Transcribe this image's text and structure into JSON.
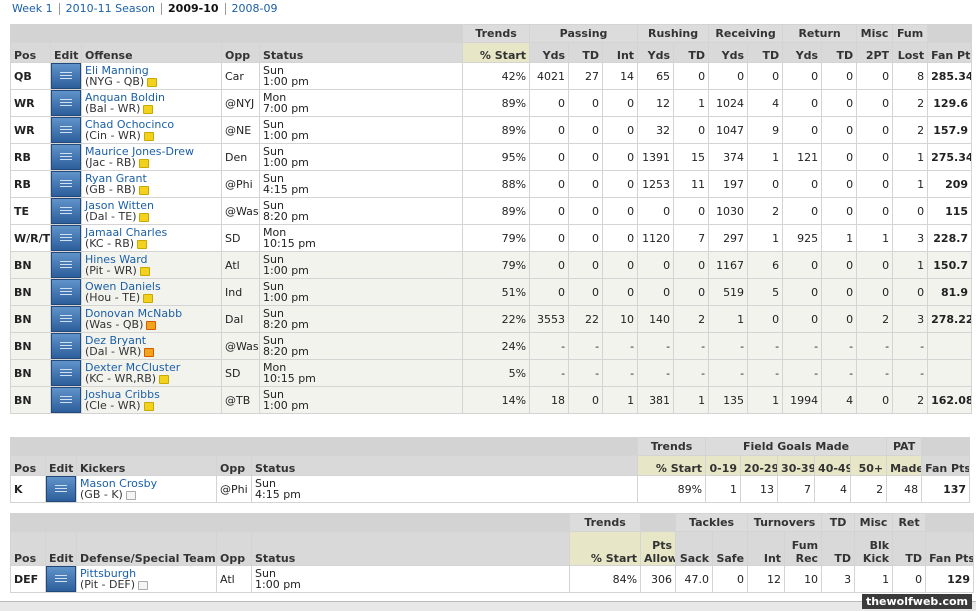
{
  "nav": {
    "items": [
      {
        "label": "Week 1",
        "current": false
      },
      {
        "label": "2010-11 Season",
        "current": false
      },
      {
        "label": "2009-10",
        "current": true
      },
      {
        "label": "2008-09",
        "current": false
      }
    ]
  },
  "offense": {
    "groups": [
      "Trends",
      "Passing",
      "Rushing",
      "Receiving",
      "Return",
      "Misc",
      "Fum"
    ],
    "headers": {
      "pos": "Pos",
      "edit": "Edit",
      "name": "Offense",
      "opp": "Opp",
      "status": "Status",
      "cols": [
        "% Start",
        "Yds",
        "TD",
        "Int",
        "Yds",
        "TD",
        "Yds",
        "TD",
        "Yds",
        "TD",
        "2PT",
        "Lost",
        "Fan Pts"
      ]
    },
    "rows": [
      {
        "pos": "QB",
        "name": "Eli Manning",
        "team": "(NYG - QB)",
        "note": "yellow",
        "opp": "Car",
        "s1": "Sun",
        "s2": "1:00 pm",
        "v": [
          "42%",
          "4021",
          "27",
          "14",
          "65",
          "0",
          "0",
          "0",
          "0",
          "0",
          "0",
          "8",
          "285.34"
        ]
      },
      {
        "pos": "WR",
        "name": "Anquan Boldin",
        "team": "(Bal - WR)",
        "note": "yellow",
        "opp": "@NYJ",
        "s1": "Mon",
        "s2": "7:00 pm",
        "v": [
          "89%",
          "0",
          "0",
          "0",
          "12",
          "1",
          "1024",
          "4",
          "0",
          "0",
          "0",
          "2",
          "129.6"
        ]
      },
      {
        "pos": "WR",
        "name": "Chad Ochocinco",
        "team": "(Cin - WR)",
        "note": "yellow",
        "opp": "@NE",
        "s1": "Sun",
        "s2": "1:00 pm",
        "v": [
          "89%",
          "0",
          "0",
          "0",
          "32",
          "0",
          "1047",
          "9",
          "0",
          "0",
          "0",
          "2",
          "157.9"
        ]
      },
      {
        "pos": "RB",
        "name": "Maurice Jones-Drew",
        "team": "(Jac - RB)",
        "note": "yellow",
        "opp": "Den",
        "s1": "Sun",
        "s2": "1:00 pm",
        "v": [
          "95%",
          "0",
          "0",
          "0",
          "1391",
          "15",
          "374",
          "1",
          "121",
          "0",
          "0",
          "1",
          "275.34"
        ]
      },
      {
        "pos": "RB",
        "name": "Ryan Grant",
        "team": "(GB - RB)",
        "note": "yellow",
        "opp": "@Phi",
        "s1": "Sun",
        "s2": "4:15 pm",
        "v": [
          "88%",
          "0",
          "0",
          "0",
          "1253",
          "11",
          "197",
          "0",
          "0",
          "0",
          "0",
          "1",
          "209"
        ]
      },
      {
        "pos": "TE",
        "name": "Jason Witten",
        "team": "(Dal - TE)",
        "note": "yellow",
        "opp": "@Was",
        "s1": "Sun",
        "s2": "8:20 pm",
        "v": [
          "89%",
          "0",
          "0",
          "0",
          "0",
          "0",
          "1030",
          "2",
          "0",
          "0",
          "0",
          "0",
          "115"
        ]
      },
      {
        "pos": "W/R/T",
        "name": "Jamaal Charles",
        "team": "(KC - RB)",
        "note": "yellow",
        "opp": "SD",
        "s1": "Mon",
        "s2": "10:15 pm",
        "v": [
          "79%",
          "0",
          "0",
          "0",
          "1120",
          "7",
          "297",
          "1",
          "925",
          "1",
          "1",
          "3",
          "228.7"
        ]
      },
      {
        "pos": "BN",
        "name": "Hines Ward",
        "team": "(Pit - WR)",
        "note": "yellow",
        "opp": "Atl",
        "s1": "Sun",
        "s2": "1:00 pm",
        "v": [
          "79%",
          "0",
          "0",
          "0",
          "0",
          "0",
          "1167",
          "6",
          "0",
          "0",
          "0",
          "1",
          "150.7"
        ]
      },
      {
        "pos": "BN",
        "name": "Owen Daniels",
        "team": "(Hou - TE)",
        "note": "yellow",
        "opp": "Ind",
        "s1": "Sun",
        "s2": "1:00 pm",
        "v": [
          "51%",
          "0",
          "0",
          "0",
          "0",
          "0",
          "519",
          "5",
          "0",
          "0",
          "0",
          "0",
          "81.9"
        ]
      },
      {
        "pos": "BN",
        "name": "Donovan McNabb",
        "team": "(Was - QB)",
        "note": "star",
        "opp": "Dal",
        "s1": "Sun",
        "s2": "8:20 pm",
        "v": [
          "22%",
          "3553",
          "22",
          "10",
          "140",
          "2",
          "1",
          "0",
          "0",
          "0",
          "2",
          "3",
          "278.22"
        ]
      },
      {
        "pos": "BN",
        "name": "Dez Bryant",
        "team": "(Dal - WR)",
        "note": "star",
        "opp": "@Was",
        "s1": "Sun",
        "s2": "8:20 pm",
        "v": [
          "24%",
          "-",
          "-",
          "-",
          "-",
          "-",
          "-",
          "-",
          "-",
          "-",
          "-",
          "-",
          ""
        ]
      },
      {
        "pos": "BN",
        "name": "Dexter McCluster",
        "team": "(KC - WR,RB)",
        "note": "yellow",
        "opp": "SD",
        "s1": "Mon",
        "s2": "10:15 pm",
        "v": [
          "5%",
          "-",
          "-",
          "-",
          "-",
          "-",
          "-",
          "-",
          "-",
          "-",
          "-",
          "-",
          ""
        ]
      },
      {
        "pos": "BN",
        "name": "Joshua Cribbs",
        "team": "(Cle - WR)",
        "note": "yellow",
        "opp": "@TB",
        "s1": "Sun",
        "s2": "1:00 pm",
        "v": [
          "14%",
          "18",
          "0",
          "1",
          "381",
          "1",
          "135",
          "1",
          "1994",
          "4",
          "0",
          "2",
          "162.08"
        ]
      }
    ]
  },
  "kickers": {
    "groups": [
      "Trends",
      "Field Goals Made",
      "PAT"
    ],
    "headers": {
      "pos": "Pos",
      "edit": "Edit",
      "name": "Kickers",
      "opp": "Opp",
      "status": "Status",
      "cols": [
        "% Start",
        "0-19",
        "20-29",
        "30-39",
        "40-49",
        "50+",
        "Made",
        "Fan Pts"
      ]
    },
    "rows": [
      {
        "pos": "K",
        "name": "Mason Crosby",
        "team": "(GB - K)",
        "note": "gray",
        "opp": "@Phi",
        "s1": "Sun",
        "s2": "4:15 pm",
        "v": [
          "89%",
          "1",
          "13",
          "7",
          "4",
          "2",
          "48",
          "137"
        ]
      }
    ]
  },
  "defense": {
    "groups": [
      "Trends",
      "Pts",
      "Tackles",
      "Turnovers",
      "TD",
      "Misc",
      "Ret"
    ],
    "headers": {
      "pos": "Pos",
      "edit": "Edit",
      "name": "Defense/Special Teams",
      "opp": "Opp",
      "status": "Status",
      "cols": [
        "% Start",
        "Allow",
        "Sack",
        "Safe",
        "Int",
        "Fum Rec",
        "TD",
        "Blk Kick",
        "TD",
        "Fan Pts"
      ],
      "split": [
        [
          "",
          ""
        ],
        [
          "Pts",
          "Allow"
        ],
        [
          "",
          "Sack"
        ],
        [
          "",
          "Safe"
        ],
        [
          "",
          "Int"
        ],
        [
          "Fum",
          "Rec"
        ],
        [
          "",
          "TD"
        ],
        [
          "Blk",
          "Kick"
        ],
        [
          "",
          "TD"
        ],
        [
          "",
          "Fan Pts"
        ]
      ]
    },
    "rows": [
      {
        "pos": "DEF",
        "name": "Pittsburgh",
        "team": "(Pit - DEF)",
        "note": "gray",
        "opp": "Atl",
        "s1": "Sun",
        "s2": "1:00 pm",
        "v": [
          "84%",
          "306",
          "47.0",
          "0",
          "12",
          "10",
          "3",
          "1",
          "0",
          "129"
        ]
      }
    ]
  },
  "watermark": "thewolfweb.com"
}
